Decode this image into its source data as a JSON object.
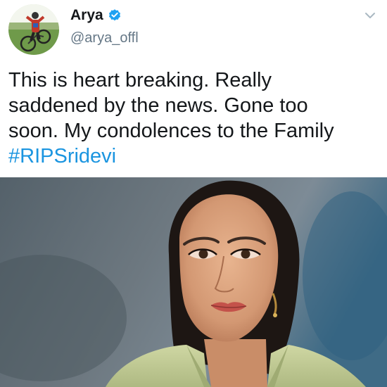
{
  "tweet": {
    "display_name": "Arya",
    "handle": "@arya_offl",
    "verified": true,
    "body_lines": [
      "This is heart breaking. Really",
      "saddened by the news. Gone too",
      "soon. My condolences to the Family"
    ],
    "hashtag": "#RIPSridevi",
    "colors": {
      "hashtag": "#1b95e0",
      "verified_badge": "#1da1f2",
      "handle": "#657786",
      "text": "#14171a"
    },
    "icons": {
      "verified": "verified-badge-icon",
      "menu": "chevron-down-icon"
    }
  }
}
